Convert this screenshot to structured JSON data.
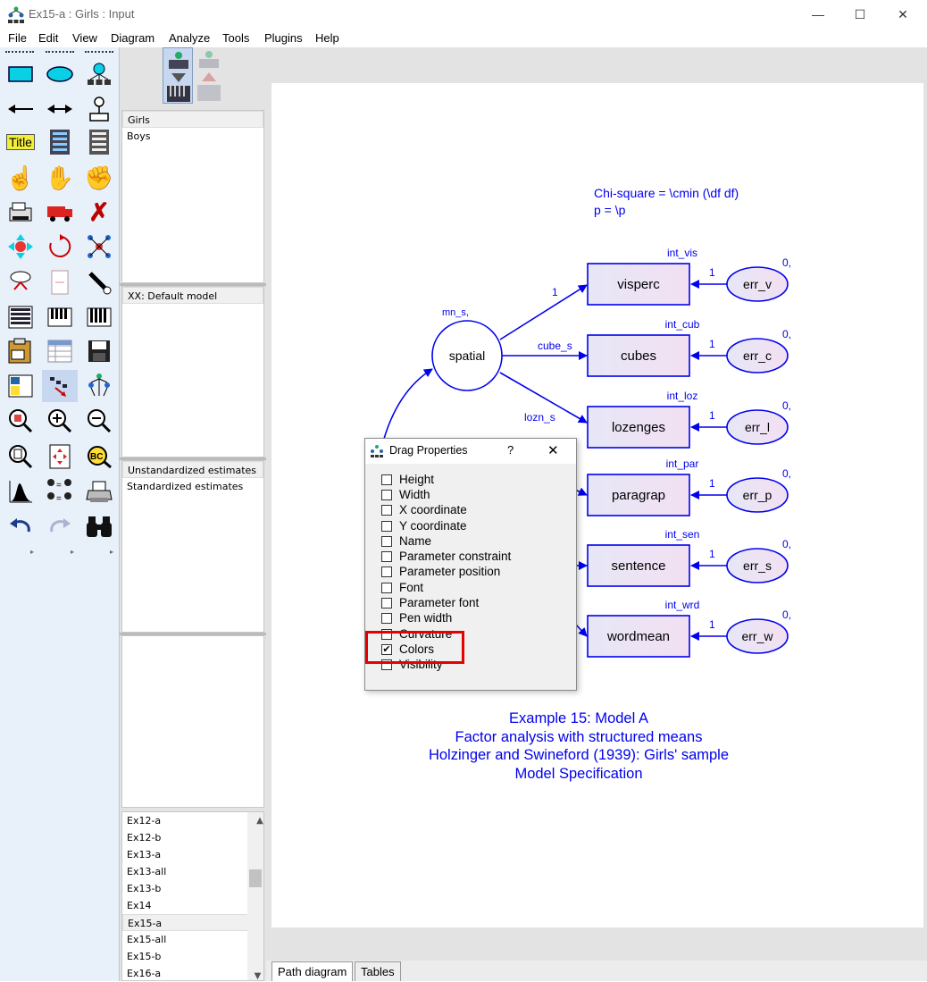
{
  "window": {
    "title": "Ex15-a : Girls : Input",
    "minimize": "—",
    "maximize": "☐",
    "close": "✕"
  },
  "menu": [
    "File",
    "Edit",
    "View",
    "Diagram",
    "Analyze",
    "Tools",
    "Plugins",
    "Help"
  ],
  "toolbox": {
    "icons": [
      "rectangle-icon",
      "ellipse-icon",
      "indicator-icon",
      "single-arrow-icon",
      "double-arrow-icon",
      "unique-variable-icon",
      "title-icon",
      "list-variables-icon",
      "list-data-variables-icon",
      "select-one-icon",
      "select-all-icon",
      "deselect-all-icon",
      "duplicate-icon",
      "move-icon",
      "erase-icon",
      "move-parameter-icon",
      "rotate-icon",
      "reflect-icon",
      "scroll-icon",
      "touch-up-icon",
      "data-files-icon",
      "analysis-properties-icon",
      "calculate-estimates-icon",
      "copy-diagram-icon",
      "text-output-icon",
      "save-icon",
      "object-properties-icon",
      "drag-properties-icon",
      "preserve-symmetries-icon",
      "zoom-select-icon",
      "zoom-in-icon",
      "zoom-out-icon",
      "view-page-icon",
      "fit-to-page-icon",
      "loupe-icon",
      "bayesian-icon",
      "multigroup-icon",
      "print-icon",
      "undo-icon",
      "redo-icon",
      "specification-search-icon"
    ],
    "title_label": "Title"
  },
  "panels": {
    "groups": [
      "Girls",
      "Boys"
    ],
    "models": [
      "XX: Default model"
    ],
    "estimates": [
      "Unstandardized estimates",
      "Standardized estimates"
    ],
    "files": [
      "Ex12-a",
      "Ex12-b",
      "Ex13-a",
      "Ex13-all",
      "Ex13-b",
      "Ex14",
      "Ex15-a",
      "Ex15-all",
      "Ex15-b",
      "Ex16-a"
    ]
  },
  "diagram": {
    "header_lines": [
      "Chi-square = \\cmin (\\df df)",
      "p = \\p"
    ],
    "latent": {
      "name": "spatial",
      "mean_label": "mn_s,"
    },
    "paths": [
      "1",
      "cube_s",
      "lozn_s"
    ],
    "indicators": [
      {
        "name": "visperc",
        "intercept": "int_vis",
        "error": "err_v",
        "err_weight": "1",
        "err_mean": "0,"
      },
      {
        "name": "cubes",
        "intercept": "int_cub",
        "error": "err_c",
        "err_weight": "1",
        "err_mean": "0,"
      },
      {
        "name": "lozenges",
        "intercept": "int_loz",
        "error": "err_l",
        "err_weight": "1",
        "err_mean": "0,"
      },
      {
        "name": "paragrap",
        "intercept": "int_par",
        "error": "err_p",
        "err_weight": "1",
        "err_mean": "0,"
      },
      {
        "name": "sentence",
        "intercept": "int_sen",
        "error": "err_s",
        "err_weight": "1",
        "err_mean": "0,"
      },
      {
        "name": "wordmean",
        "intercept": "int_wrd",
        "error": "err_w",
        "err_weight": "1",
        "err_mean": "0,"
      }
    ],
    "caption": [
      "Example 15: Model A",
      "Factor analysis with structured means",
      "Holzinger and Swineford (1939):  Girls' sample",
      "Model Specification"
    ],
    "colors": {
      "diagram_blue": "#0000ee",
      "box_fill": "#ece0f4"
    }
  },
  "dialog": {
    "title": "Drag Properties",
    "help": "?",
    "close": "✕",
    "items": [
      {
        "label": "Height",
        "checked": false
      },
      {
        "label": "Width",
        "checked": false
      },
      {
        "label": "X coordinate",
        "checked": false
      },
      {
        "label": "Y coordinate",
        "checked": false
      },
      {
        "label": "Name",
        "checked": false
      },
      {
        "label": "Parameter constraint",
        "checked": false
      },
      {
        "label": "Parameter position",
        "checked": false
      },
      {
        "label": "Font",
        "checked": false
      },
      {
        "label": "Parameter font",
        "checked": false
      },
      {
        "label": "Pen width",
        "checked": false
      },
      {
        "label": "Curvature",
        "checked": false
      },
      {
        "label": "Colors",
        "checked": true
      },
      {
        "label": "Visibility",
        "checked": false
      }
    ]
  },
  "tabs": [
    "Path diagram",
    "Tables"
  ]
}
